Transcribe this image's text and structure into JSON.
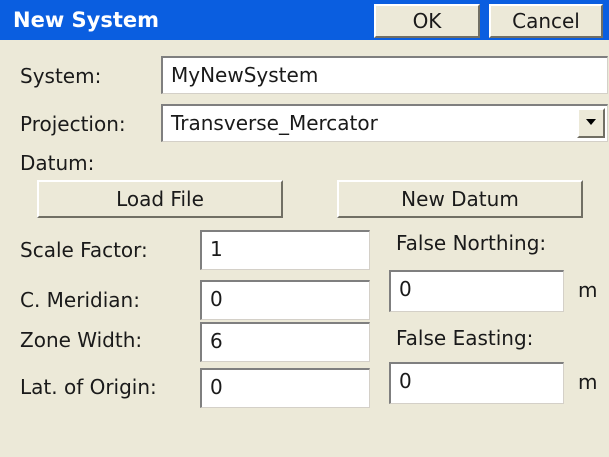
{
  "dialog": {
    "title": "New System",
    "ok_label": "OK",
    "cancel_label": "Cancel"
  },
  "system": {
    "label": "System:",
    "value": "MyNewSystem"
  },
  "projection": {
    "label": "Projection:",
    "value": "Transverse_Mercator",
    "arrow_icon": "chevron-down-icon"
  },
  "datum": {
    "label": "Datum:",
    "load_file_label": "Load File",
    "new_datum_label": "New Datum"
  },
  "params": {
    "scale_factor": {
      "label": "Scale Factor:",
      "value": "1"
    },
    "c_meridian": {
      "label": "C. Meridian:",
      "value": "0"
    },
    "zone_width": {
      "label": "Zone Width:",
      "value": "6"
    },
    "lat_origin": {
      "label": "Lat. of Origin:",
      "value": "0"
    },
    "false_northing": {
      "label": "False Northing:",
      "value": "0",
      "unit": "m"
    },
    "false_easting": {
      "label": "False Easting:",
      "value": "0",
      "unit": "m"
    }
  },
  "colors": {
    "titlebar": "#0a5ee0",
    "dialog_bg": "#ece9d8"
  }
}
